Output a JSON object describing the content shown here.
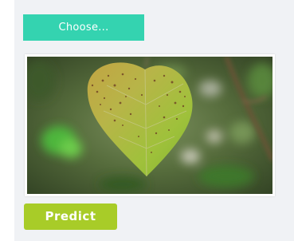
{
  "upload": {
    "choose_label": "Choose..."
  },
  "preview": {
    "image_subject": "leaf-with-spots"
  },
  "actions": {
    "predict_label": "Predict"
  },
  "colors": {
    "choose_button": "#34d3b0",
    "predict_button": "#a8cc28",
    "panel_background": "#f0f2f5"
  }
}
